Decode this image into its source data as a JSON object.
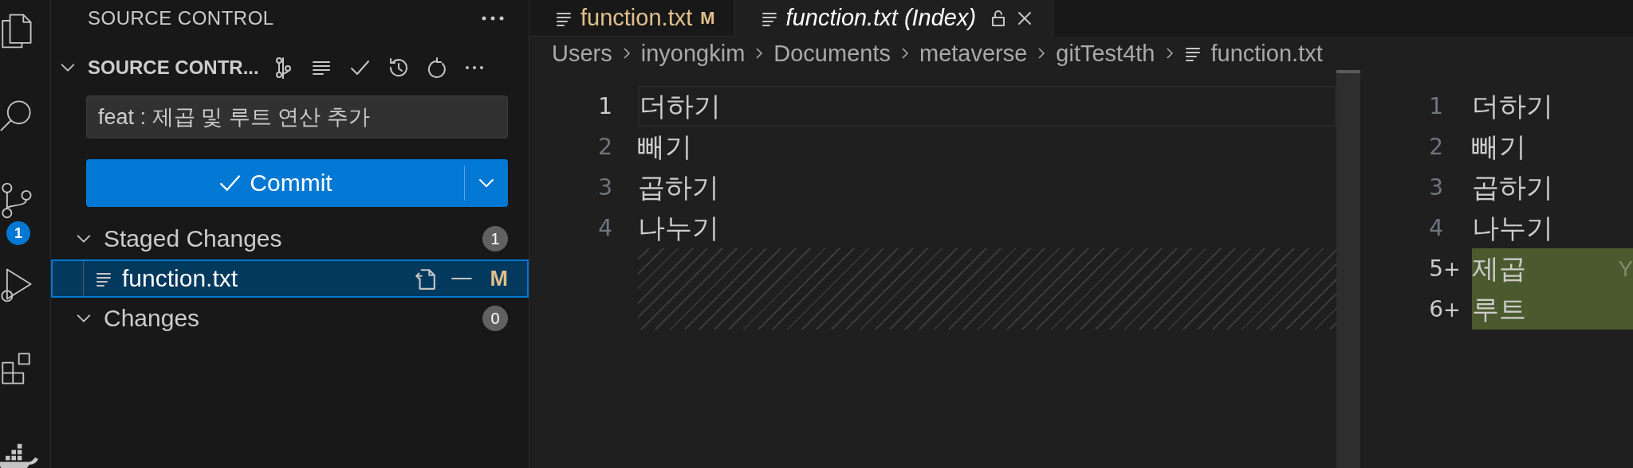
{
  "activity_bar": {
    "items": [
      {
        "kind": "files"
      },
      {
        "kind": "search"
      },
      {
        "kind": "scm",
        "badge": "1"
      },
      {
        "kind": "run"
      },
      {
        "kind": "extensions"
      },
      {
        "kind": "docker"
      }
    ]
  },
  "sidebar": {
    "title": "SOURCE CONTROL",
    "section": {
      "title": "SOURCE CONTR...",
      "expanded": true
    },
    "commit_message": {
      "value": "feat : 제곱 및 루트 연산 추가"
    },
    "commit_button": {
      "label": "Commit"
    },
    "groups": [
      {
        "label": "Staged Changes",
        "count": "1",
        "expanded": true,
        "files": [
          {
            "name": "function.txt",
            "status": "M",
            "selected": true
          }
        ]
      },
      {
        "label": "Changes",
        "count": "0",
        "expanded": true
      }
    ]
  },
  "editor": {
    "tabs": [
      {
        "label": "function.txt",
        "status": "M",
        "selected": false,
        "preview": false,
        "locked": false
      },
      {
        "label": "function.txt (Index)",
        "selected": true,
        "preview": true,
        "locked": true
      }
    ],
    "breadcrumbs": [
      {
        "label": "Users",
        "kind": "folder"
      },
      {
        "label": "inyongkim",
        "kind": "folder"
      },
      {
        "label": "Documents",
        "kind": "folder"
      },
      {
        "label": "metaverse",
        "kind": "folder"
      },
      {
        "label": "gitTest4th",
        "kind": "folder"
      },
      {
        "label": "function.txt",
        "kind": "file"
      }
    ],
    "left_lines": [
      {
        "number": "1",
        "text": "더하기",
        "current": true
      },
      {
        "number": "2",
        "text": "빼기",
        "current": false
      },
      {
        "number": "3",
        "text": "곱하기",
        "current": false
      },
      {
        "number": "4",
        "text": "나누기",
        "current": false
      }
    ],
    "right_lines": [
      {
        "number": "1",
        "text": "더하기",
        "added": false
      },
      {
        "number": "2",
        "text": "빼기",
        "added": false
      },
      {
        "number": "3",
        "text": "곱하기",
        "added": false
      },
      {
        "number": "4",
        "text": "나누기",
        "added": false
      },
      {
        "number": "5",
        "marker": "+",
        "text": "제곱",
        "added": true,
        "blame": "Y"
      },
      {
        "number": "6",
        "marker": "+",
        "text": "루트",
        "added": true
      }
    ]
  }
}
